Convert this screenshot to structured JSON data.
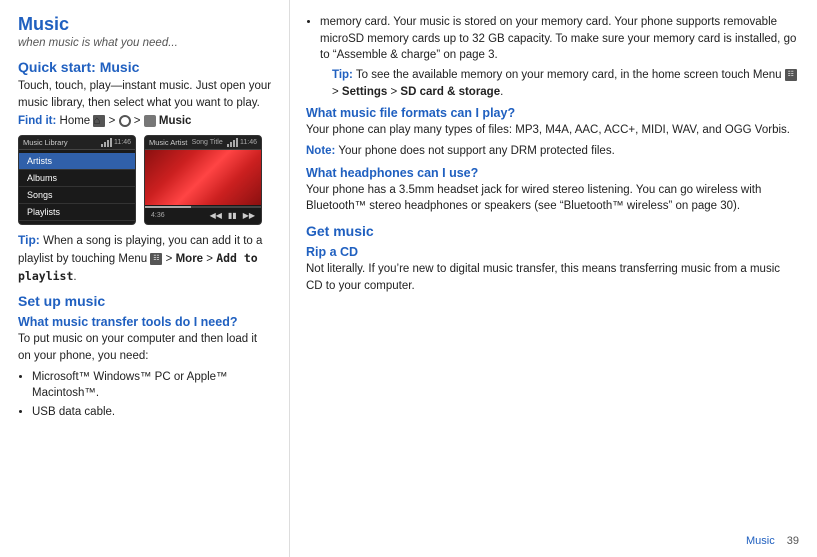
{
  "page": {
    "title": "Music",
    "subtitle": "when music is what you need...",
    "footer_label": "Music",
    "footer_page": "39"
  },
  "left": {
    "quick_start_heading": "Quick start: Music",
    "quick_start_text": "Touch, touch, play—instant music. Just open your music library, then select what you want to play.",
    "find_it_label": "Find it:",
    "find_it_text": " Home",
    "find_it_suffix": " > Music",
    "screen_left_title": "Music Library",
    "screen_left_time": "11:46",
    "screen_menu": [
      "Artists",
      "Albums",
      "Songs",
      "Playlists"
    ],
    "screen_right_title": "Music Artist",
    "screen_right_subtitle": "Song Title",
    "screen_right_time": "11:46",
    "screen_right_duration": "4:36",
    "tip_label": "Tip:",
    "tip_text": " When a song is playing, you can add it to a playlist by touching Menu",
    "tip_suffix": " > More > Add to playlist.",
    "more_label": "More",
    "add_to_playlist_label": "Add to playlist",
    "set_up_heading": "Set up music",
    "transfer_subheading": "What music transfer tools do I need?",
    "transfer_text": "To put music on your computer and then load it on your phone, you need:",
    "bullets": [
      "Microsoft™ Windows™ PC or Apple™ Macintosh™.",
      "USB data cable."
    ]
  },
  "right": {
    "memory_bullet": "memory card. Your music is stored on your memory card. Your phone supports removable microSD memory cards up to 32 GB capacity. To make sure your memory card is installed, go to “Assemble & charge” on page 3.",
    "tip_label": "Tip:",
    "tip_memory_text": " To see the available memory on your memory card, in the home screen touch Menu",
    "tip_memory_suffix": " > Settings > SD card & storage.",
    "settings_label": "Settings",
    "sd_label": "SD card & storage",
    "formats_heading": "What music file formats can I play?",
    "formats_text": "Your phone can play many types of files: MP3, M4A, AAC, ACC+, MIDI, WAV, and OGG Vorbis.",
    "note_label": "Note:",
    "note_text": " Your phone does not support any DRM protected files.",
    "headphones_heading": "What headphones can I use?",
    "headphones_text": "Your phone has a 3.5mm headset jack for wired stereo listening. You can go wireless with Bluetooth™ stereo headphones or speakers (see “Bluetooth™ wireless” on page 30).",
    "get_music_heading": "Get music",
    "rip_cd_subheading": "Rip a CD",
    "rip_cd_text": "Not literally. If you’re new to digital music transfer, this means transferring music from a music CD to your computer."
  }
}
